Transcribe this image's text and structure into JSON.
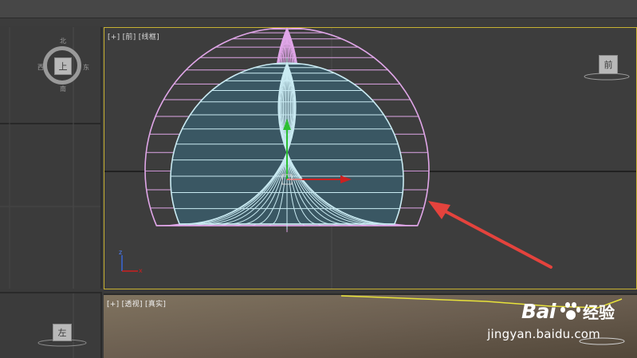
{
  "viewports": {
    "front": {
      "label": "[+] [前] [线框]"
    },
    "perspective": {
      "label": "[+] [透视] [真实]"
    },
    "top": {
      "viewcube_label": "上",
      "compass": {
        "west": "西",
        "east": "东",
        "south": "南",
        "north": "北"
      }
    },
    "left": {
      "viewcube_label": "左"
    }
  },
  "front_viewcube": {
    "label": "前"
  },
  "axis_tripod": {
    "z": "z",
    "x": "x"
  },
  "watermark": {
    "brand_latin": "Bai",
    "brand_cn": "经验",
    "url": "jingyan.baidu.com"
  },
  "colors": {
    "outer_hemisphere": "#e0a6e8",
    "inner_hemisphere": "#c9eaf2",
    "inner_fill": "#3a5763",
    "arrow": "#e4433d",
    "active_border": "#c8b232",
    "gizmo_y": "#2bbf32",
    "gizmo_x": "#cc2020"
  }
}
